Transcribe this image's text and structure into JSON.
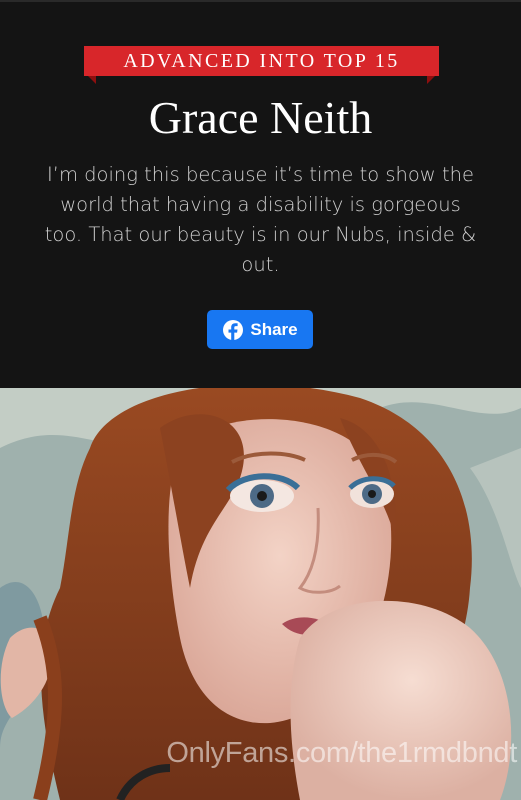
{
  "banner": {
    "label": "ADVANCED INTO TOP 15",
    "color": "#d8262a"
  },
  "contestant": {
    "name": "Grace Neith",
    "statement": "I’m doing this because it’s time to show the world that having a disability is gorgeous too. That our beauty is in our Nubs, inside & out."
  },
  "share_button": {
    "label": "Share",
    "icon": "facebook-icon",
    "color": "#1877f2"
  },
  "photo": {
    "watermark": "OnlyFans.com/the1rmdbndt"
  }
}
